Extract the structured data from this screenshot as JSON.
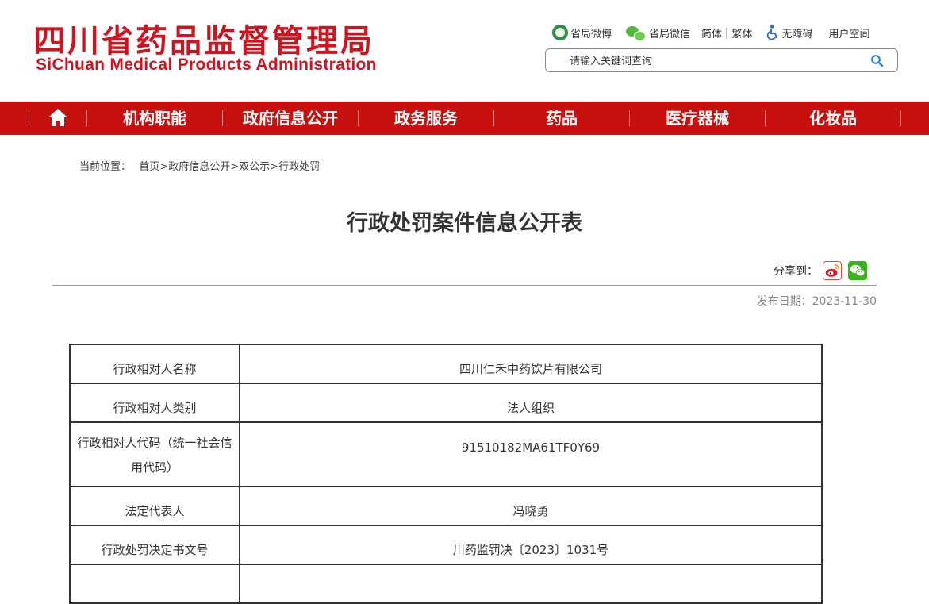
{
  "header": {
    "logo_cn": "四川省药品监督管理局",
    "logo_en": "SiChuan Medical Products Administration",
    "links": {
      "weibo": "省局微博",
      "wechat": "省局微信",
      "simplified": "简体",
      "divider": "|",
      "traditional": "繁体",
      "accessibility": "无障碍",
      "user_space": "用户空间"
    },
    "search": {
      "placeholder": "请输入关键词查询",
      "value": ""
    }
  },
  "nav": {
    "home_icon": "home-icon",
    "items": [
      "机构职能",
      "政府信息公开",
      "政务服务",
      "药品",
      "医疗器械",
      "化妆品"
    ]
  },
  "breadcrumb": {
    "label": "当前位置：",
    "items": [
      "首页",
      "政府信息公开",
      "双公示",
      "行政处罚"
    ],
    "separator": ">"
  },
  "article": {
    "title": "行政处罚案件信息公开表",
    "share_label": "分享到：",
    "publish_date": "发布日期：2023-11-30"
  },
  "table": {
    "rows": [
      {
        "key": "行政相对人名称",
        "value": "四川仁禾中药饮片有限公司"
      },
      {
        "key": "行政相对人类别",
        "value": "法人组织"
      },
      {
        "key": "行政相对人代码（统一社会信用代码）",
        "value": "91510182MA61TF0Y69"
      },
      {
        "key": "法定代表人",
        "value": "冯晓勇"
      },
      {
        "key": "行政处罚决定书文号",
        "value": "川药监罚决〔2023〕1031号"
      },
      {
        "key": "",
        "value": ""
      }
    ]
  },
  "colors": {
    "brand_red": "#d0141f",
    "nav_red": "#c8100f",
    "wechat_green": "#38b51d"
  }
}
